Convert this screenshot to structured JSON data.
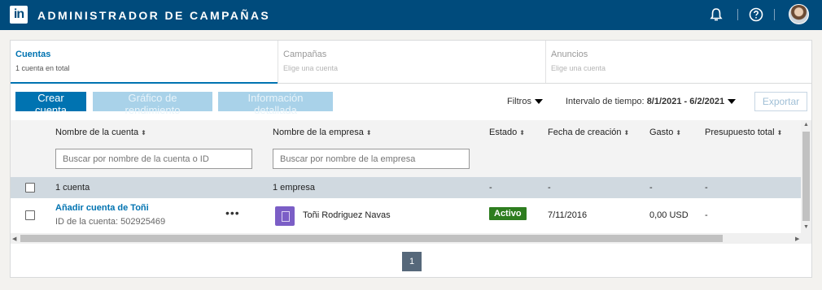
{
  "header": {
    "logo_text": "in",
    "title": "ADMINISTRADOR DE CAMPAÑAS",
    "icons": [
      "bell-icon",
      "help-icon",
      "avatar"
    ]
  },
  "tabs": [
    {
      "label": "Cuentas",
      "sub": "1 cuenta en total",
      "active": true
    },
    {
      "label": "Campañas",
      "sub": "Elige una cuenta",
      "active": false
    },
    {
      "label": "Anuncios",
      "sub": "Elige una cuenta",
      "active": false
    }
  ],
  "toolbar": {
    "create_account": "Crear cuenta",
    "performance_chart": "Gráfico de rendimiento",
    "detailed_info": "Información detallada",
    "filters": "Filtros",
    "time_range_label": "Intervalo de tiempo:",
    "time_range_value": "8/1/2021 - 6/2/2021",
    "export": "Exportar"
  },
  "table": {
    "columns": [
      "Nombre de la cuenta",
      "Nombre de la empresa",
      "Estado",
      "Fecha de creación",
      "Gasto",
      "Presupuesto total"
    ],
    "search_account_placeholder": "Buscar por nombre de la cuenta o ID",
    "search_company_placeholder": "Buscar por nombre de la empresa",
    "totals": {
      "accounts": "1 cuenta",
      "companies": "1 empresa",
      "status": "-",
      "date": "-",
      "spend": "-",
      "budget": "-"
    },
    "rows": [
      {
        "account_name": "Añadir cuenta de Toñi",
        "account_id": "ID de la cuenta: 502925469",
        "more": "•••",
        "company": "Toñi Rodriguez Navas",
        "status": "Activo",
        "created": "7/11/2016",
        "spend": "0,00 USD",
        "budget": "-"
      }
    ]
  },
  "pagination": {
    "current": "1"
  },
  "colors": {
    "brand": "#004b7c",
    "accent": "#0073b1",
    "status_active": "#2e7d1f"
  }
}
